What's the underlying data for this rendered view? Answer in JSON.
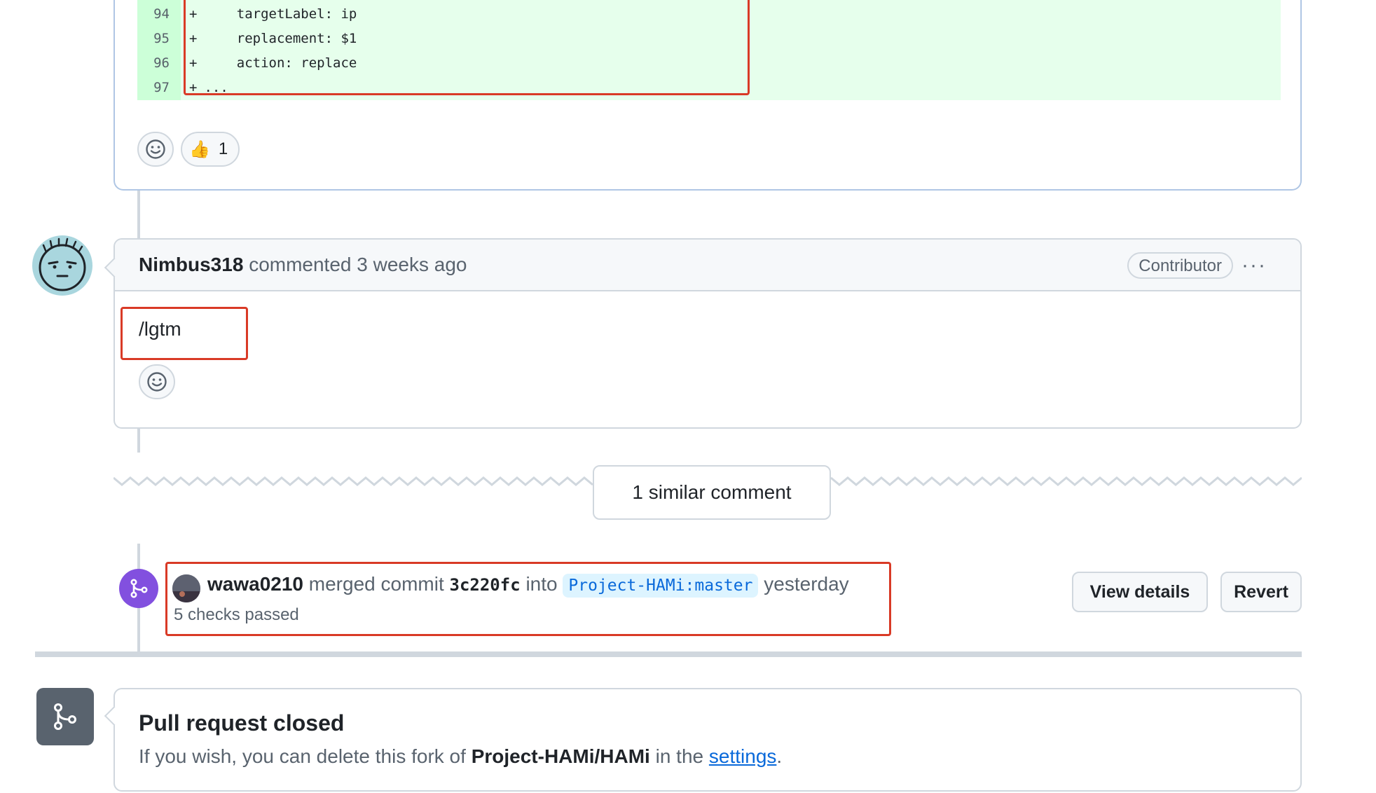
{
  "diff": {
    "rows": [
      {
        "line": "94",
        "sign": "+",
        "code": "    targetLabel: ip"
      },
      {
        "line": "95",
        "sign": "+",
        "code": "    replacement: $1"
      },
      {
        "line": "96",
        "sign": "+",
        "code": "    action: replace"
      },
      {
        "line": "97",
        "sign": "+",
        "code": " ..."
      }
    ]
  },
  "review_reactions": {
    "thumbs_emoji": "👍",
    "thumbs_count": "1"
  },
  "comment": {
    "author": "Nimbus318",
    "action": "commented",
    "time": "3 weeks ago",
    "badge": "Contributor",
    "more": "···",
    "body": "/lgtm"
  },
  "similar": {
    "label": "1 similar comment"
  },
  "merge": {
    "user": "wawa0210",
    "verb": "merged commit",
    "sha": "3c220fc",
    "into": "into",
    "branch": "Project-HAMi:master",
    "time": "yesterday",
    "checks": "5 checks passed",
    "view_details": "View details",
    "revert": "Revert"
  },
  "closed": {
    "title": "Pull request closed",
    "desc_prefix": "If you wish, you can delete this fork of",
    "repo": "Project-HAMi/HAMi",
    "desc_middle": "in the",
    "link": "settings",
    "desc_suffix": "."
  },
  "colors": {
    "merged_purple": "#8250df",
    "closed_gray": "#59636e",
    "highlight_red": "#d93a26",
    "diff_green": "#e6ffec"
  }
}
